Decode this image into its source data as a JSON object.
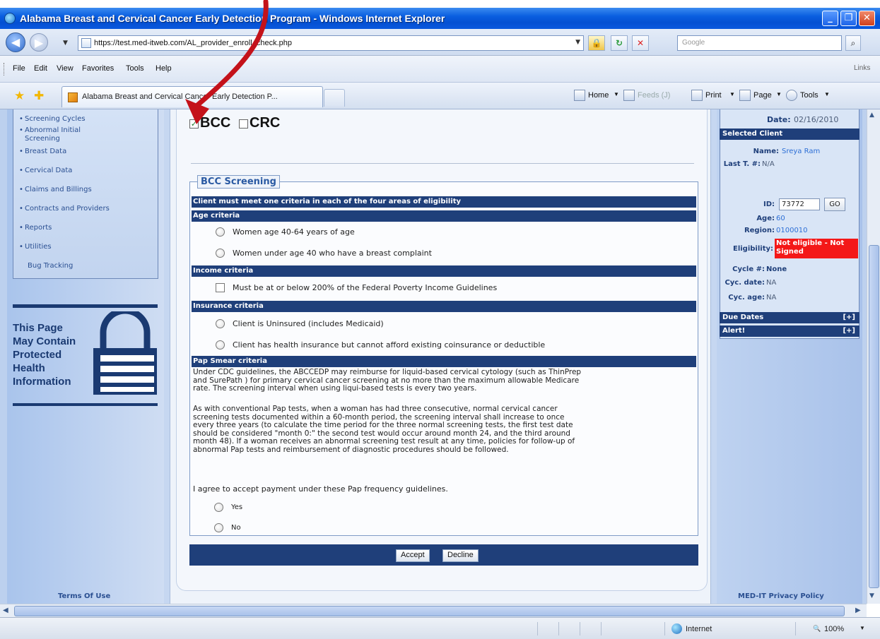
{
  "window": {
    "title": "Alabama Breast and Cervical Cancer Early Detection Program - Windows Internet Explorer",
    "url": "https://test.med-itweb.com/AL_provider_enroll_check.php",
    "search_placeholder": "Google"
  },
  "menu": [
    "File",
    "Edit",
    "View",
    "Favorites",
    "Tools",
    "Help"
  ],
  "menu_links": "Links",
  "tab": {
    "label": "Alabama Breast and Cervical Cancer Early Detection P..."
  },
  "commandbar": {
    "home": "Home",
    "feeds": "Feeds (J)",
    "print": "Print",
    "page": "Page",
    "tools": "Tools"
  },
  "leftnav": {
    "items": [
      "Screening Cycles",
      "Abnormal Initial",
      "Screening",
      "Breast Data",
      "Cervical Data",
      "Claims and Billings",
      "Contracts and Providers",
      "Reports",
      "Utilities",
      "Bug Tracking"
    ],
    "phi_line1": "This Page",
    "phi_line2": "May Contain",
    "phi_line3": "Protected",
    "phi_line4": "Health",
    "phi_line5": "Information",
    "terms": "Terms Of Use"
  },
  "programs": {
    "bcc": {
      "label": "BCC",
      "checked": true
    },
    "crc": {
      "label": "CRC",
      "checked": false
    }
  },
  "screening": {
    "legend": "BCC Screening",
    "intro_bar": "Client must meet one criteria in each of the four areas of eligibility",
    "age_header": "Age criteria",
    "age_options": [
      "Women age 40-64 years of age",
      "Women under age 40 who have a breast complaint"
    ],
    "income_header": "Income criteria",
    "income_option": "Must be at or below 200% of the Federal Poverty Income Guidelines",
    "insurance_header": "Insurance criteria",
    "insurance_options": [
      "Client is Uninsured (includes Medicaid)",
      "Client has health insurance but cannot afford existing coinsurance or deductible"
    ],
    "pap_header": "Pap Smear criteria",
    "pap_para1_l1": "Under CDC guidelines, the ABCCEDP may reimburse for liquid-based cervical cytology (such as ThinPrep",
    "pap_para1_l2": "and SurePath ) for primary cervical cancer screening at no more than the maximum allowable Medicare",
    "pap_para1_l3": "rate. The screening interval when using liqui-based tests is every two years.",
    "pap_para2_l1": "As with conventional Pap tests, when a woman has had three consecutive, normal cervical cancer",
    "pap_para2_l2": "screening tests documented within a 60-month period, the screening interval shall increase to once",
    "pap_para2_l3": "every three years (to calculate the time period for the three normal screening tests, the first test date",
    "pap_para2_l4": "should be considered \"month 0:\" the second test would occur around month 24, and the third around",
    "pap_para2_l5": "month 48). If a woman receives an abnormal screening test result at any time, policies for follow-up of",
    "pap_para2_l6": "abnormal Pap tests and reimbursement of diagnostic procedures should be followed.",
    "agree_text": "I agree to accept payment under these Pap frequency guidelines.",
    "yes": "Yes",
    "no": "No",
    "accept": "Accept",
    "decline": "Decline"
  },
  "rightpanel": {
    "date_label": "Date:",
    "date_value": "02/16/2010",
    "selected_client": "Selected Client",
    "name_label": "Name:",
    "name_value": "Sreya Ram",
    "lastt_label": "Last T. #:",
    "lastt_value": "N/A",
    "id_label": "ID:",
    "id_value": "73772",
    "go": "GO",
    "age_label": "Age:",
    "age_value": "60",
    "region_label": "Region:",
    "region_value": "0100010",
    "eligibility_label": "Eligibility:",
    "eligibility_value": "Not eligible - Not Signed",
    "cycle_label": "Cycle #:",
    "cycle_value": "None",
    "cycdate_label": "Cyc. date:",
    "cycdate_value": "NA",
    "cycage_label": "Cyc. age:",
    "cycage_value": "NA",
    "due_dates": "Due Dates",
    "alert": "Alert!",
    "expand": "[+]",
    "privacy": "MED-IT Privacy Policy"
  },
  "statusbar": {
    "zone": "Internet",
    "zoom": "100%"
  },
  "colors": {
    "header_bar": "#1f3f7a",
    "link_blue": "#2d6fd6",
    "eligibility_bg": "#f41818",
    "annotation_arrow": "#c4121a"
  }
}
